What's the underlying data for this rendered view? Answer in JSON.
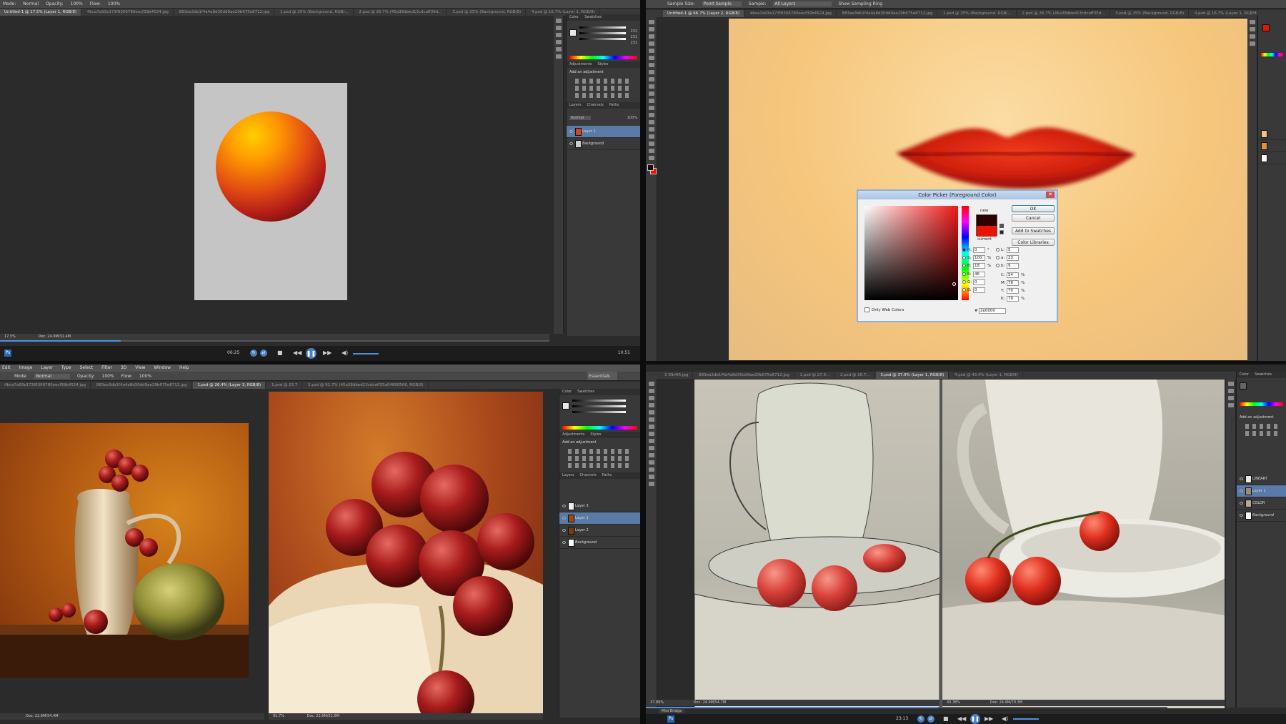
{
  "q1": {
    "options": [
      "Mode:",
      "Normal",
      "Opacity:",
      "100%",
      "Flow:",
      "100%"
    ],
    "tabs": [
      "Untitled-1 @ 17.5% (Layer 1, RGB/8)",
      "4bca7a93e173f8306780eecf39b4524.jpg",
      "883ea3db1f4a4a8d30dd9ae29b675e8712.jpg",
      "1.psd @ 25% (Background, RGB/...",
      "2.psd @ 26.7% (45a38dbed13cdcaff39d...",
      "3.psd @ 25% (Background, RGB/8)",
      "4.psd @ 16.7% (Layer 1, RGB/8)"
    ],
    "panel_tabs": [
      "Color",
      "Swatches"
    ],
    "color_values": [
      "232",
      "231",
      "231"
    ],
    "adj_tabs": [
      "Adjustments",
      "Styles"
    ],
    "adj_title": "Add an adjustment",
    "layer_tabs": [
      "Layers",
      "Channels",
      "Paths"
    ],
    "blend": "Normal",
    "opacity": "100%",
    "layers": [
      {
        "name": "Layer 1"
      },
      {
        "name": "Background"
      }
    ],
    "zoom": "17.5%",
    "doc": "Doc: 24.9M/31.4M",
    "time_elapsed": "06:25",
    "time_total": "10:51",
    "playback_position": 0.22
  },
  "q2": {
    "options": [
      "Sample Size:",
      "Point Sample",
      "Sample:",
      "All Layers",
      "Show Sampling Ring"
    ],
    "tabs": [
      "Untitled-1 @ 66.7% (Layer 2, RGB/8)",
      "4bca7a93e173f8306780eecf39b4524.jpg",
      "883ea3db1f4a4a8d30dd9ae29b675e8712.jpg",
      "1.psd @ 25% (Background, RGB/...",
      "2.psd @ 26.7% (45a38dbed13cdcaff35d...",
      "3.psd @ 25% (Background, RGB/8)",
      "4.psd @ 16.7% (Layer 1, RGB/8)"
    ],
    "dialog": {
      "title": "Color Picker (Foreground Color)",
      "ok": "OK",
      "cancel": "Cancel",
      "add_swatches": "Add to Swatches",
      "libraries": "Color Libraries",
      "new_label": "new",
      "current_label": "current",
      "only_web": "Only Web Colors",
      "fields": [
        {
          "label": "H:",
          "value": "0",
          "unit": "°"
        },
        {
          "label": "S:",
          "value": "100",
          "unit": "%"
        },
        {
          "label": "B:",
          "value": "18",
          "unit": "%"
        },
        {
          "label": "R:",
          "value": "46",
          "unit": ""
        },
        {
          "label": "G:",
          "value": "0",
          "unit": ""
        },
        {
          "label": "B:",
          "value": "0",
          "unit": ""
        }
      ],
      "lab": [
        {
          "label": "L:",
          "value": "5"
        },
        {
          "label": "a:",
          "value": "23"
        },
        {
          "label": "b:",
          "value": "9"
        }
      ],
      "cmyk": [
        {
          "label": "C:",
          "value": "54",
          "unit": "%"
        },
        {
          "label": "M:",
          "value": "78",
          "unit": "%"
        },
        {
          "label": "Y:",
          "value": "70",
          "unit": "%"
        },
        {
          "label": "K:",
          "value": "79",
          "unit": "%"
        }
      ],
      "hex_label": "#",
      "hex": "2e0000",
      "new_color": "#2e0000",
      "current_color": "#e81400"
    }
  },
  "q3": {
    "menu": [
      "Edit",
      "Image",
      "Layer",
      "Type",
      "Select",
      "Filter",
      "3D",
      "View",
      "Window",
      "Help"
    ],
    "options": [
      "Mode:",
      "Normal",
      "Opacity:",
      "100%",
      "Flow:",
      "100%"
    ],
    "workspace": "Essentials",
    "tabs": [
      "4bca7a93e173f8306780eecf39b4524.jpg",
      "883ea3db1f4a4a8d30dd9ae29b675e8712.jpg",
      "1.psd @ 26.4% (Layer 3, RGB/8)",
      "1.psd @ 23.7",
      "2.psd @ 91.7% (45a38dbed13cdcaff35a04868566, RGB/8)"
    ],
    "layers": [
      {
        "name": "Layer 3"
      },
      {
        "name": "Layer 1"
      },
      {
        "name": "Layer 2"
      },
      {
        "name": "Background"
      }
    ],
    "adj_title": "Add an adjustment",
    "doc_left": "Doc: 22.6M/54.4M",
    "zoom_right": "91.7%",
    "doc_right": "Doc: 22.6M/21.6M"
  },
  "q4": {
    "tabs": [
      "3 f0b4f5.jpg",
      "883ea3db1f4a4a8d30dd9ae29b675e8712.jpg",
      "1.psd @ 27.9...",
      "2.psd @ 26.7...",
      "3.psd @ 37.9% (Layer 1, RGB/8)",
      "4.psd @ 43.4% (Layer 1, RGB/8)"
    ],
    "layers": [
      {
        "name": "LINEART"
      },
      {
        "name": "Layer 1"
      },
      {
        "name": "COLOR"
      },
      {
        "name": "Background"
      }
    ],
    "adj_title": "Add an adjustment",
    "zoom_left": "37.89%",
    "doc_left": "Doc: 24.9M/54.7M",
    "zoom_right": "43.38%",
    "doc_right": "Doc: 24.9M/70.3M",
    "time_elapsed": "23:13",
    "playback_position": 0.56,
    "mini_bridge": "Mini Bridge"
  }
}
